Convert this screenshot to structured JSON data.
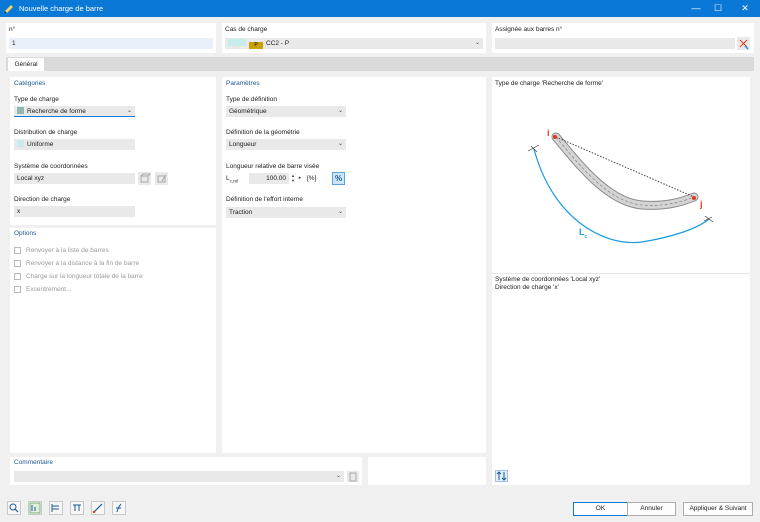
{
  "window": {
    "title": "Nouvelle charge de barre"
  },
  "top": {
    "no_label": "n°",
    "no_value": "1",
    "loadcase_label": "Cas de charge",
    "loadcase_tag": "P",
    "loadcase_value": "CC2 - P",
    "assigned_label": "Assignée aux barres n°",
    "assigned_value": ""
  },
  "tabs": [
    {
      "label": "Général"
    }
  ],
  "categories": {
    "header": "Catégories",
    "load_type_label": "Type de charge",
    "load_type_value": "Recherche de forme",
    "distribution_label": "Distribution de charge",
    "distribution_value": "Uniforme",
    "coord_label": "Système de coordonnées",
    "coord_value": "Local xyz",
    "direction_label": "Direction de charge",
    "direction_value": "x"
  },
  "options": {
    "header": "Options",
    "items": [
      {
        "label": "Renvoyer à la liste de barres",
        "checked": false
      },
      {
        "label": "Renvoyer à la distance à la fin de barre",
        "checked": false
      },
      {
        "label": "Charge sur la longueur totale de la barre",
        "checked": false
      },
      {
        "label": "Excentrement...",
        "checked": false
      }
    ]
  },
  "params": {
    "header": "Paramètres",
    "def_type_label": "Type de définition",
    "def_type_value": "Géométrique",
    "geom_label": "Définition de la géométrie",
    "geom_value": "Longueur",
    "rel_len_label": "Longueur relative de barre visée",
    "rel_len_symbol_main": "L",
    "rel_len_symbol_sub": "c,rel",
    "rel_len_value": "100.00",
    "rel_len_unit": "[%]",
    "percent_btn": "%",
    "internal_force_label": "Définition de l'effort interne",
    "internal_force_value": "Traction"
  },
  "preview": {
    "title": "Type de charge 'Recherche de forme'",
    "label_i": "i",
    "label_j": "j",
    "label_lc_main": "L",
    "label_lc_sub": "c",
    "info_line1": "Système de coordonnées 'Local xyz'",
    "info_line2": "Direction de charge 'x'"
  },
  "comment": {
    "label": "Commentaire",
    "value": ""
  },
  "buttons": {
    "ok": "OK",
    "cancel": "Annuler",
    "apply_next": "Appliquer & Suivant"
  },
  "colors": {
    "titlebar": "#0a78d7",
    "header_text": "#1d5a94",
    "load_type_swatch": "#8fb8b0",
    "distribution_swatch": "#c6ecec",
    "loadcase_swatch1": "#c6ecec",
    "loadcase_swatch2": "#c8a000",
    "curve_blue": "#1a9be0",
    "node_red": "#e03a1e"
  }
}
